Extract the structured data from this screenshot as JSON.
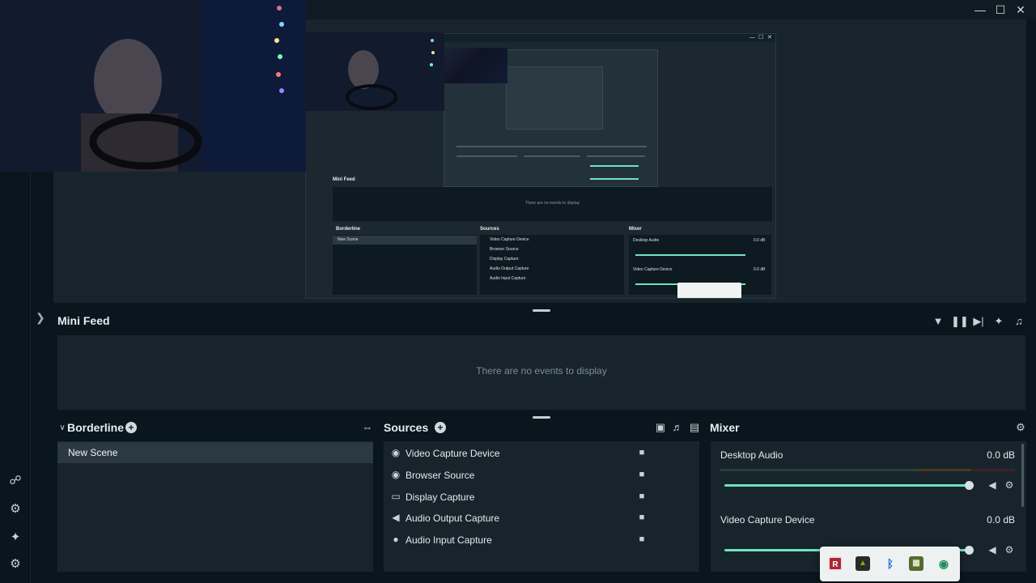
{
  "feed": {
    "title": "Mini Feed",
    "empty_text": "There are no events to display"
  },
  "scenes": {
    "title": "Borderline",
    "items": [
      "New Scene"
    ]
  },
  "sources": {
    "title": "Sources",
    "items": [
      {
        "label": "Video Capture Device",
        "icon": "webcam-icon"
      },
      {
        "label": "Browser Source",
        "icon": "globe-icon"
      },
      {
        "label": "Display Capture",
        "icon": "monitor-icon"
      },
      {
        "label": "Audio Output Capture",
        "icon": "speaker-icon"
      },
      {
        "label": "Audio Input Capture",
        "icon": "microphone-icon"
      }
    ]
  },
  "mixer": {
    "title": "Mixer",
    "channels": [
      {
        "name": "Desktop Audio",
        "db": "0.0 dB",
        "volume": 1.0
      },
      {
        "name": "Video Capture Device",
        "db": "0.0 dB",
        "volume": 1.0
      }
    ]
  },
  "colors": {
    "background": "#09161d",
    "panel": "#17242c",
    "accent": "#6fe3bf",
    "selected": "#2b3942"
  }
}
